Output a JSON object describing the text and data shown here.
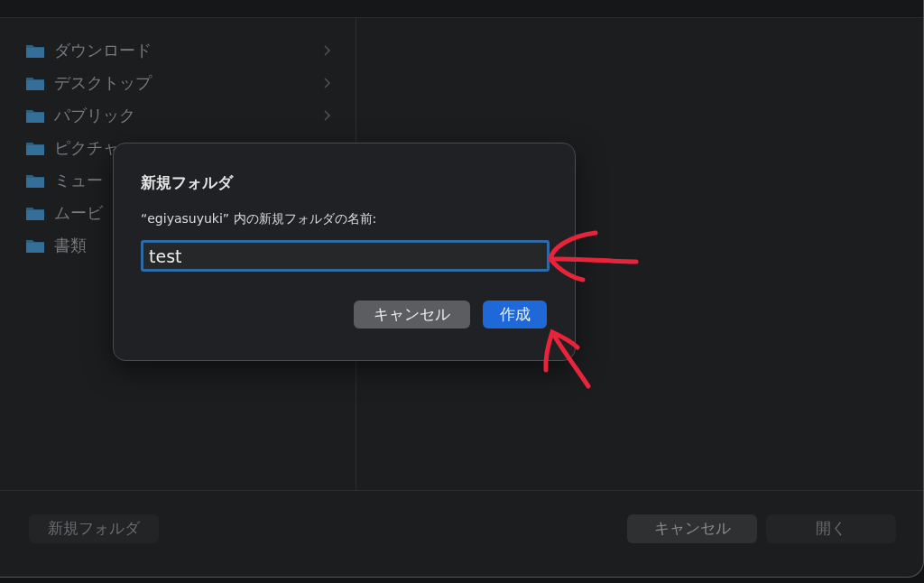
{
  "sidebar": {
    "items": [
      {
        "label": "ダウンロード"
      },
      {
        "label": "デスクトップ"
      },
      {
        "label": "パブリック"
      },
      {
        "label": "ピクチャ"
      },
      {
        "label": "ミュー"
      },
      {
        "label": "ムービ"
      },
      {
        "label": "書類"
      }
    ]
  },
  "dialog": {
    "title": "新規フォルダ",
    "prompt": "“egiyasuyuki” 内の新規フォルダの名前:",
    "name_field": {
      "value": "test"
    },
    "buttons": [
      {
        "label": "キャンセル",
        "kind": "secondary"
      },
      {
        "label": "作成",
        "kind": "primary"
      }
    ]
  },
  "footer": {
    "left_buttons": [
      {
        "label": "新規フォルダ",
        "disabled": true
      }
    ],
    "right_buttons": [
      {
        "label": "キャンセル",
        "disabled": false
      },
      {
        "label": "開く",
        "disabled": true
      }
    ]
  }
}
